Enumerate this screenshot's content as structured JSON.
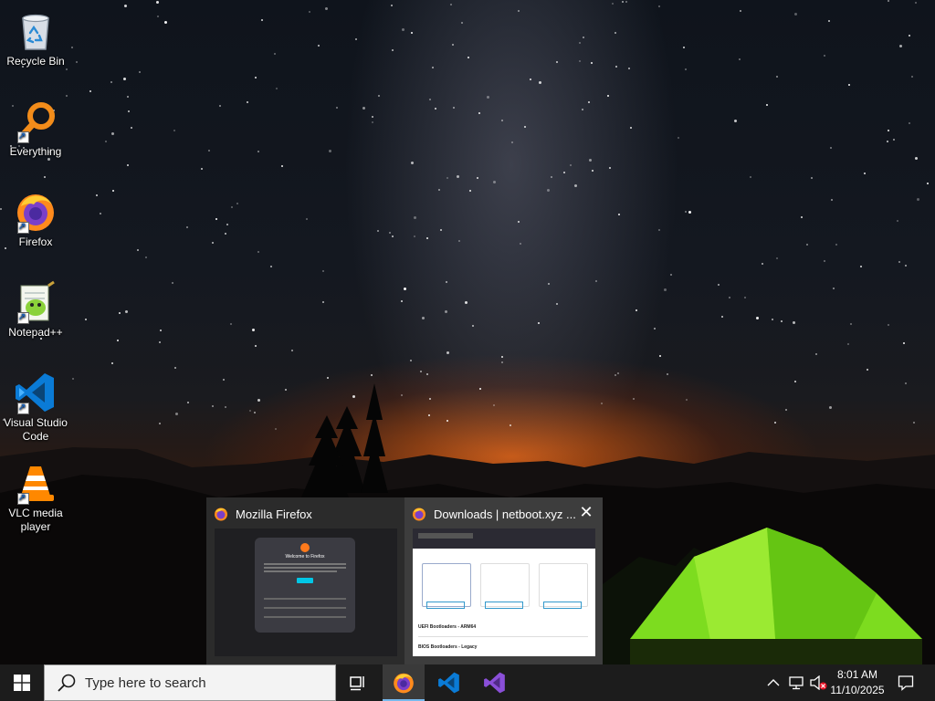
{
  "desktop": {
    "icons": [
      {
        "label": "Recycle Bin",
        "icon": "recycle-bin-icon"
      },
      {
        "label": "Everything",
        "icon": "everything-search-icon"
      },
      {
        "label": "Firefox",
        "icon": "firefox-icon"
      },
      {
        "label": "Notepad++",
        "icon": "notepad-plus-plus-icon"
      },
      {
        "label": "Visual Studio Code",
        "icon": "vscode-icon"
      },
      {
        "label": "VLC media player",
        "icon": "vlc-icon"
      }
    ]
  },
  "taskbar_preview": {
    "windows": [
      {
        "title": "Mozilla Firefox",
        "icon": "firefox-icon",
        "dialog_title": "Welcome to Firefox"
      },
      {
        "title": "Downloads | netboot.xyz ...",
        "icon": "firefox-icon",
        "rows": [
          "UEFI Bootloaders - ARM64",
          "BIOS Bootloaders - Legacy"
        ]
      }
    ],
    "close_glyph": "✕"
  },
  "taskbar": {
    "search_placeholder": "Type here to search",
    "pinned": [
      {
        "name": "firefox",
        "icon": "firefox-icon",
        "active": true
      },
      {
        "name": "vscode",
        "icon": "vscode-icon",
        "active": false
      },
      {
        "name": "visual-studio",
        "icon": "visual-studio-icon",
        "active": false
      }
    ],
    "clock": {
      "time": "8:01 AM",
      "date": "11/10/2025"
    },
    "tray_icons": [
      "chevron-up-icon",
      "network-icon",
      "volume-muted-icon",
      "notifications-icon"
    ]
  },
  "colors": {
    "taskbar_bg": "#1c1c1c",
    "accent": "#76b9ed"
  }
}
